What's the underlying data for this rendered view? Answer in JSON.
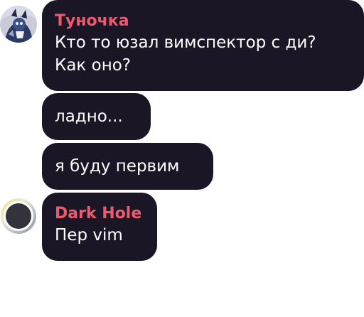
{
  "messages": [
    {
      "sender": "Туночка",
      "lines": [
        "Кто то юзал вимспектор с ди?",
        "Как оно?"
      ]
    },
    {
      "text": "ладно..."
    },
    {
      "text": "я буду первим"
    },
    {
      "sender": "Dark Hole",
      "lines": [
        "Пер vim"
      ]
    }
  ],
  "colors": {
    "bubble_background": "#1a1626",
    "sender_name": "#ec5a6e",
    "message_text": "#ffffff",
    "page_background": "#ffffff"
  },
  "icons": {
    "avatar_1": "user-avatar-icon",
    "avatar_2": "user-avatar-icon"
  }
}
